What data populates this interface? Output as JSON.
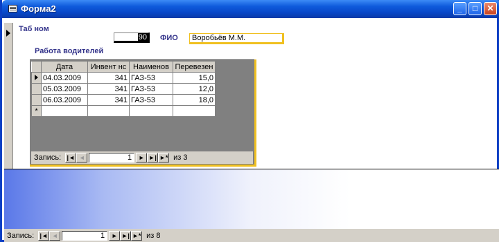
{
  "window": {
    "title": "Форма2",
    "minimize": "_",
    "maximize": "□",
    "close": "✕"
  },
  "form": {
    "tab_label": "Таб ном",
    "tab_value": "90",
    "fio_label": "ФИО",
    "fio_value": "Воробьёв М.М.",
    "section_title": "Работа водителей"
  },
  "subform": {
    "columns": [
      "Дата",
      "Инвент нс",
      "Наименов",
      "Перевезен"
    ],
    "rows": [
      [
        "04.03.2009",
        "341",
        "ГАЗ-53",
        "15,0"
      ],
      [
        "05.03.2009",
        "341",
        "ГАЗ-53",
        "12,0"
      ],
      [
        "06.03.2009",
        "341",
        "ГАЗ-53",
        "18,0"
      ]
    ],
    "new_row_marker": "*",
    "nav": {
      "label": "Запись:",
      "current": "1",
      "total": "из 3"
    }
  },
  "main_nav": {
    "label": "Запись:",
    "current": "1",
    "total": "из 8"
  },
  "nav_icons": {
    "first": "|◄",
    "prev": "◄",
    "next": "►",
    "last": "►|",
    "new": "►*"
  }
}
